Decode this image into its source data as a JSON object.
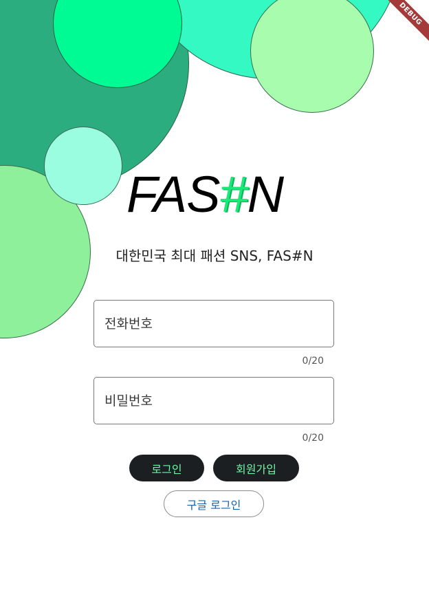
{
  "debug_banner": "DEBUG",
  "logo": {
    "part1": "FAS",
    "hash": "#",
    "part2": "N"
  },
  "subtitle": "대한민국 최대 패션 SNS, FAS#N",
  "phone_field": {
    "placeholder": "전화번호",
    "counter": "0/20"
  },
  "password_field": {
    "placeholder": "비밀번호",
    "counter": "0/20"
  },
  "buttons": {
    "login": "로그인",
    "signup": "회원가입",
    "google_login": "구글 로그인"
  },
  "colors": {
    "accent": "#1be878",
    "button_bg": "#1b1f22",
    "button_text": "#6ef6a6",
    "link_text": "#1a5fa8"
  }
}
